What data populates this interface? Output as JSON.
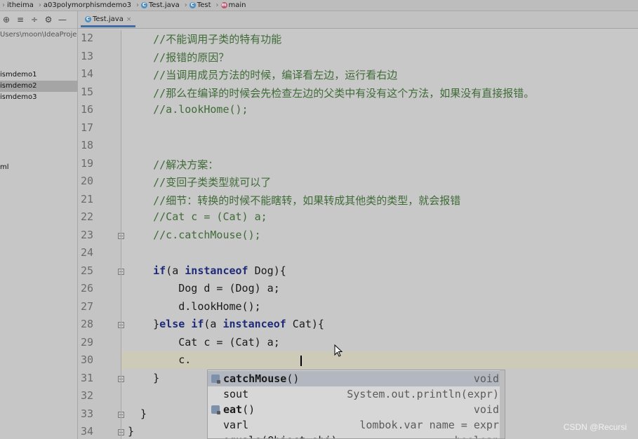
{
  "breadcrumb": [
    {
      "label": "itheima",
      "icon": null
    },
    {
      "label": "a03polymorphismdemo3",
      "icon": null
    },
    {
      "label": "Test.java",
      "icon": "class-icon"
    },
    {
      "label": "Test",
      "icon": "class-icon"
    },
    {
      "label": "main",
      "icon": "method-icon"
    }
  ],
  "project_panel": {
    "items": [
      {
        "label": "Users\\moon\\IdeaProje",
        "kind": "path"
      },
      {
        "label": "ismdemo1",
        "kind": "folder"
      },
      {
        "label": "ismdemo2",
        "kind": "folder",
        "selected": true
      },
      {
        "label": "ismdemo3",
        "kind": "folder"
      },
      {
        "label": "ml",
        "kind": "file"
      }
    ]
  },
  "editor": {
    "tab_label": "Test.java",
    "first_line": 12,
    "lines": [
      "    //不能调用子类的特有功能",
      "    //报错的原因？",
      "    //当调用成员方法的时候，编译看左边，运行看右边",
      "    //那么在编译的时候会先检查左边的父类中有没有这个方法，如果没有直接报错。",
      "    //a.lookHome();",
      "",
      "",
      "    //解决方案：",
      "    //变回子类类型就可以了",
      "    //细节：转换的时候不能瞎转，如果转成其他类的类型，就会报错",
      "    //Cat c = (Cat) a;",
      "    //c.catchMouse();",
      "",
      "    if(a instanceof Dog){",
      "        Dog d = (Dog) a;",
      "        d.lookHome();",
      "    }else if(a instanceof Cat){",
      "        Cat c = (Cat) a;",
      "        c.",
      "    }",
      "",
      "  }",
      "}"
    ]
  },
  "completion": {
    "items": [
      {
        "name": "catchMouse",
        "suffix": "()",
        "type": "void",
        "selected": true,
        "bold": true
      },
      {
        "name": "sout",
        "suffix": "",
        "type": "System.out.println(expr)",
        "selected": false,
        "bold": false
      },
      {
        "name": "eat",
        "suffix": "()",
        "type": "void",
        "selected": false,
        "bold": true
      },
      {
        "name": "varl",
        "suffix": "",
        "type": "lombok.var name = expr",
        "selected": false,
        "bold": false
      },
      {
        "name": "equals(Object obj)",
        "suffix": "",
        "type": "boolean",
        "selected": false,
        "bold": false
      }
    ]
  },
  "watermark": "CSDN @Recursi"
}
